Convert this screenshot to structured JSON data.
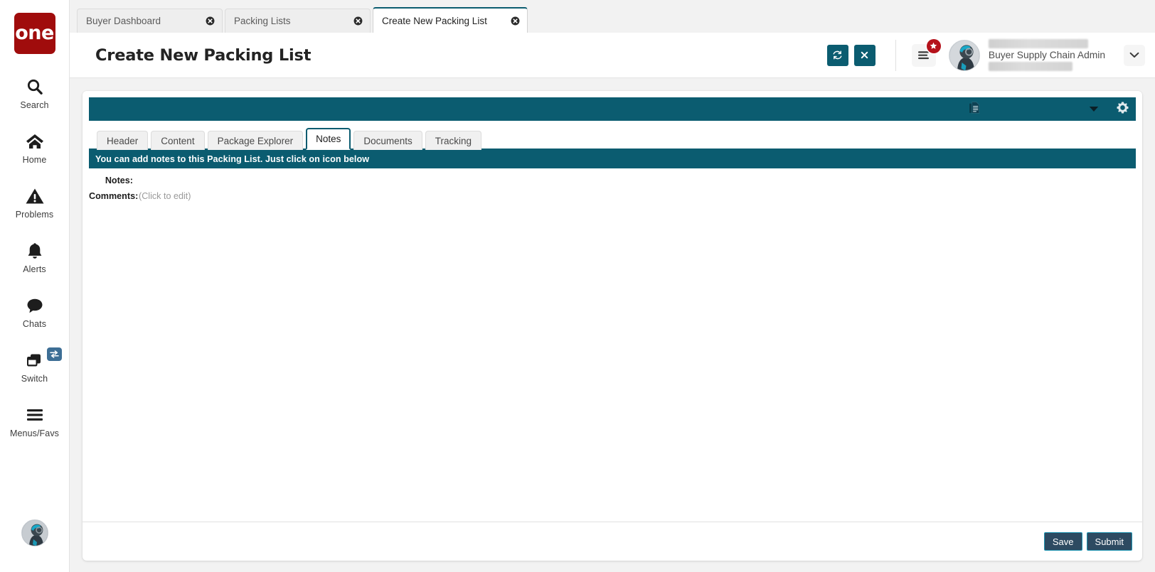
{
  "brand": {
    "logo_text": "one",
    "logo_color": "#a00c0c"
  },
  "theme": {
    "teal": "#0b5c70",
    "button_navy": "#2d4a61",
    "button_border": "#1e93b0",
    "badge_red": "#b5121b"
  },
  "sidebar": {
    "items": [
      {
        "label": "Search",
        "icon": "search-icon"
      },
      {
        "label": "Home",
        "icon": "home-icon"
      },
      {
        "label": "Problems",
        "icon": "warning-triangle-icon"
      },
      {
        "label": "Alerts",
        "icon": "bell-icon"
      },
      {
        "label": "Chats",
        "icon": "chat-bubble-icon"
      },
      {
        "label": "Switch",
        "icon": "switch-windows-icon"
      },
      {
        "label": "Menus/Favs",
        "icon": "hamburger-icon"
      }
    ]
  },
  "browser_tabs": [
    {
      "label": "Buyer Dashboard",
      "active": false
    },
    {
      "label": "Packing Lists",
      "active": false
    },
    {
      "label": "Create New Packing List",
      "active": true
    }
  ],
  "header": {
    "title": "Create New Packing List",
    "refresh_title": "Refresh",
    "close_title": "Close",
    "menu_title": "Menu",
    "user_name": "Buyer Supply Chain Admin",
    "user_dropdown_title": "User menu"
  },
  "toolbar": {
    "doc_icon_title": "Copy to clipboard",
    "caret_title": "More options",
    "gear_title": "Settings"
  },
  "inner_tabs": [
    {
      "label": "Header",
      "active": false
    },
    {
      "label": "Content",
      "active": false
    },
    {
      "label": "Package Explorer",
      "active": false
    },
    {
      "label": "Notes",
      "active": true
    },
    {
      "label": "Documents",
      "active": false
    },
    {
      "label": "Tracking",
      "active": false
    }
  ],
  "notice": "You can add notes to this Packing List. Just click on icon below",
  "form": {
    "notes_label": "Notes:",
    "notes_value": "",
    "comments_label": "Comments:",
    "comments_value": "(Click to edit)"
  },
  "footer": {
    "save_label": "Save",
    "submit_label": "Submit"
  }
}
